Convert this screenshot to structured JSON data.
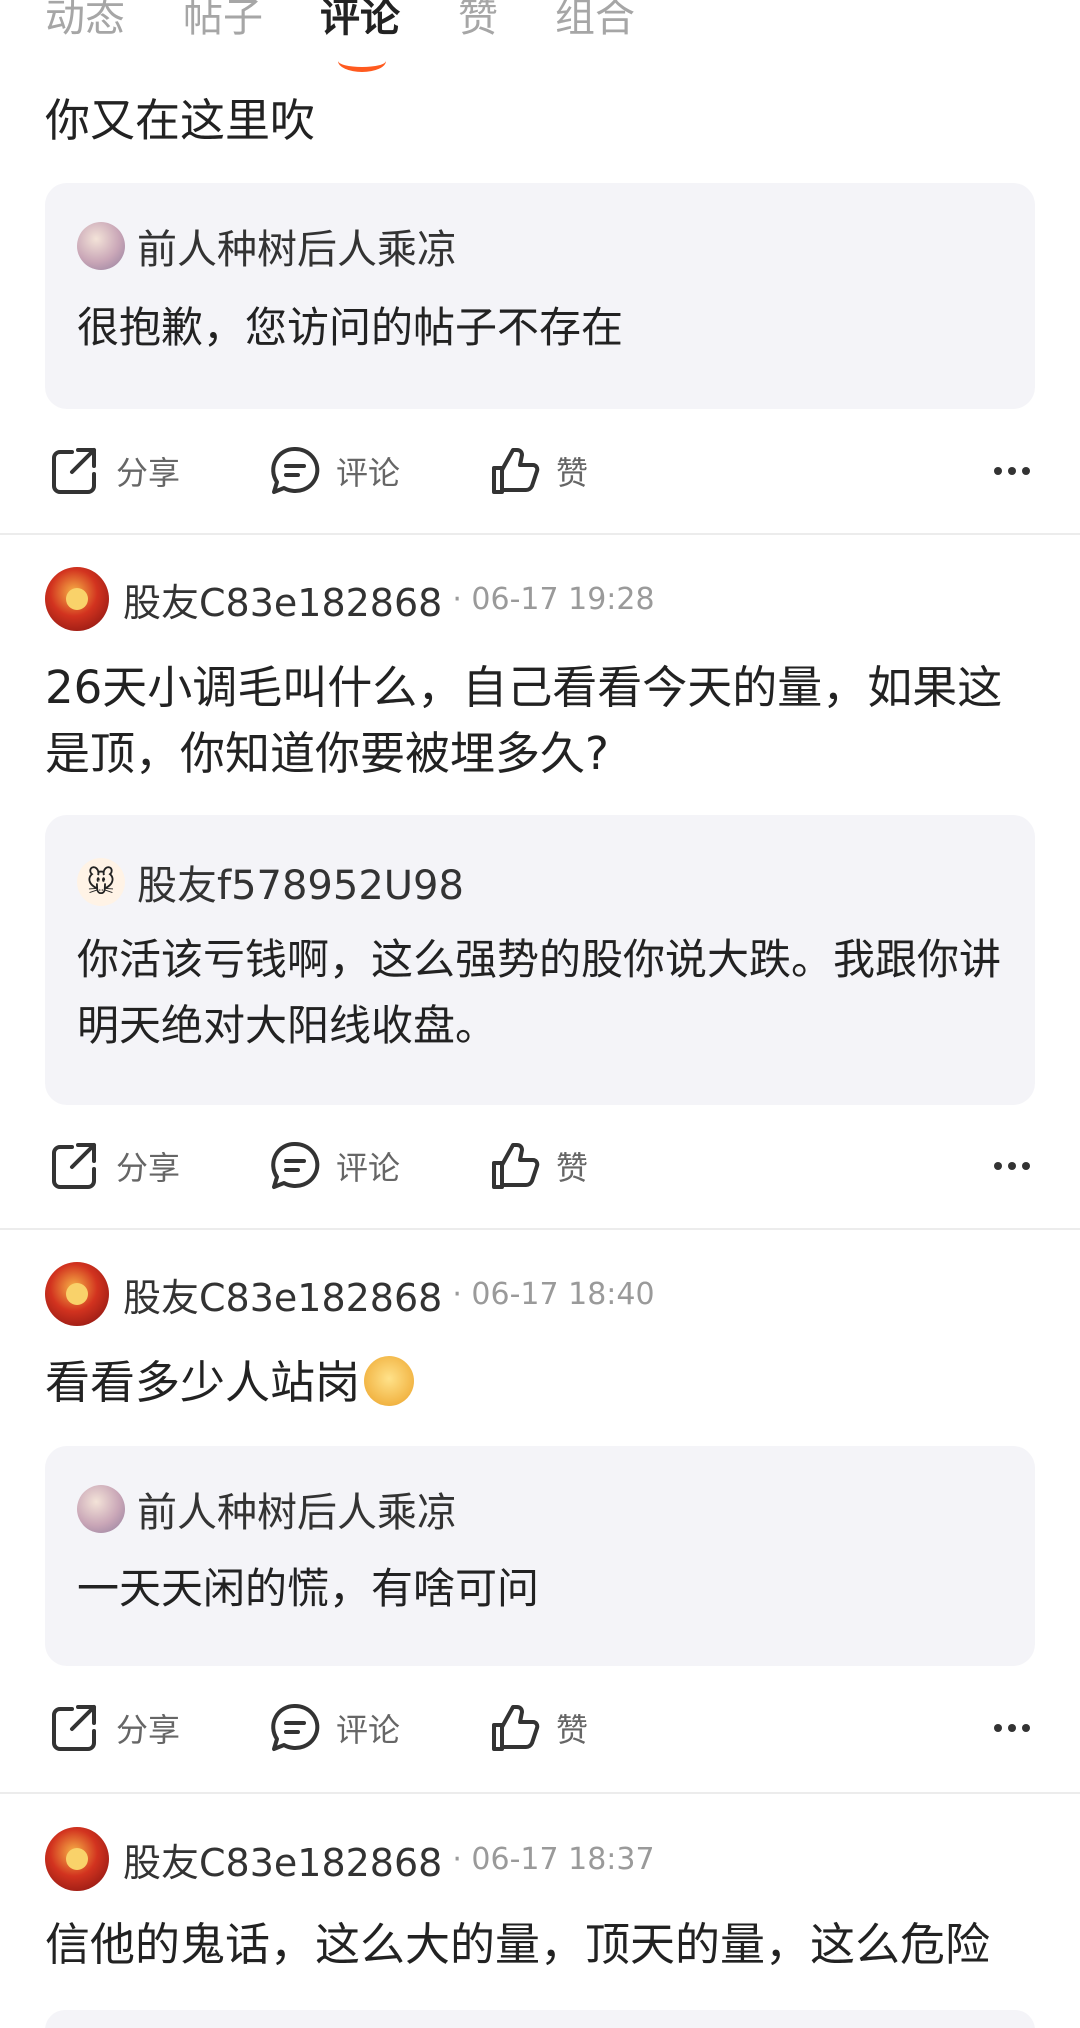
{
  "tabs": [
    {
      "label": "动态",
      "active": false
    },
    {
      "label": "帖子",
      "active": false
    },
    {
      "label": "评论",
      "active": true
    },
    {
      "label": "赞",
      "active": false
    },
    {
      "label": "组合",
      "active": false
    }
  ],
  "accent_color": "#ff5a1f",
  "actions": {
    "share": "分享",
    "comment": "评论",
    "like": "赞"
  },
  "comments": [
    {
      "text": "你又在这里吹",
      "quote": {
        "user": "前人种树后人乘凉",
        "text": "很抱歉，您访问的帖子不存在"
      }
    },
    {
      "user": "股友C83e182868",
      "time": "· 06-17 19:28",
      "text": "26天小调毛叫什么，自己看看今天的量，如果这是顶，你知道你要被埋多久?",
      "quote": {
        "user": "股友f578952U98",
        "text": "你活该亏钱啊，这么强势的股你说大跌。我跟你讲明天绝对大阳线收盘。"
      }
    },
    {
      "user": "股友C83e182868",
      "time": "· 06-17 18:40",
      "text": "看看多少人站岗",
      "emoji": "dog-face-emoji",
      "quote": {
        "user": "前人种树后人乘凉",
        "text": "一天天闲的慌，有啥可问"
      }
    },
    {
      "user": "股友C83e182868",
      "time": "· 06-17 18:37",
      "text": "信他的鬼话，这么大的量，顶天的量，这么危险"
    }
  ]
}
